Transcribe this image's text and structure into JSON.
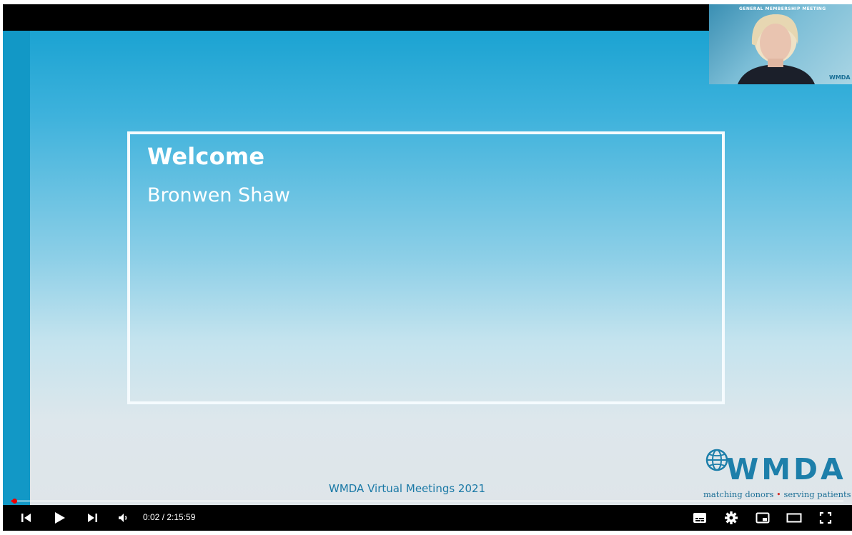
{
  "slide": {
    "title": "Welcome",
    "speaker": "Bronwen Shaw",
    "footer": "WMDA Virtual Meetings 2021"
  },
  "logo": {
    "wordmark": "WMDA",
    "tagline_left": "matching donors",
    "tagline_bullet": "•",
    "tagline_right": "serving patients",
    "color": "#1d7faa"
  },
  "webcam": {
    "banner_text": "GENERAL MEMBERSHIP MEETING",
    "logo_text": "WMDA"
  },
  "player": {
    "time_display": "0:02 / 2:15:59",
    "progress_fraction": 0.0003,
    "controls": {
      "previous": "previous-icon",
      "play": "play-icon",
      "next": "next-icon",
      "volume": "volume-icon",
      "subtitles": "subtitles-icon",
      "settings": "gear-icon",
      "miniplayer": "miniplayer-icon",
      "theater": "theater-icon",
      "fullscreen": "fullscreen-icon"
    }
  }
}
